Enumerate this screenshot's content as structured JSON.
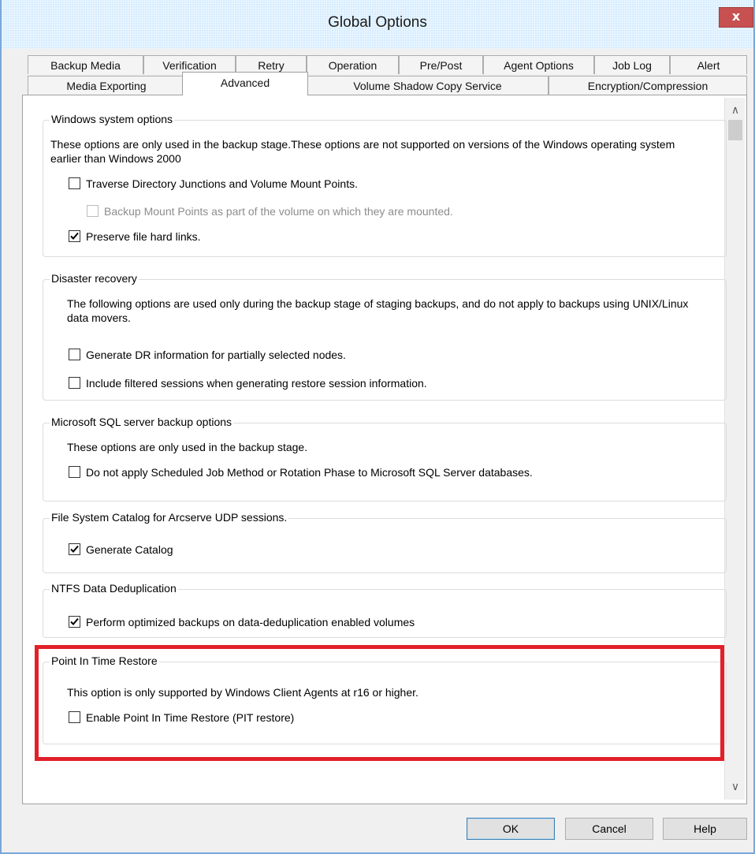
{
  "window": {
    "title": "Global Options",
    "close_glyph": "x"
  },
  "tabs_row1": [
    {
      "label": "Backup Media"
    },
    {
      "label": "Verification"
    },
    {
      "label": "Retry"
    },
    {
      "label": "Operation"
    },
    {
      "label": "Pre/Post"
    },
    {
      "label": "Agent Options"
    },
    {
      "label": "Job Log"
    },
    {
      "label": "Alert"
    }
  ],
  "tabs_row2": [
    {
      "label": "Media Exporting"
    },
    {
      "label": "Advanced",
      "active": true
    },
    {
      "label": "Volume Shadow Copy Service"
    },
    {
      "label": "Encryption/Compression"
    }
  ],
  "sections": {
    "windows": {
      "title": "Windows system options",
      "description": "These options are only used in the backup stage.These options are not supported on versions of the Windows operating system earlier than Windows 2000",
      "traverse_label": "Traverse Directory Junctions and Volume Mount Points.",
      "traverse_checked": false,
      "mount_points_label": "Backup Mount Points as part of the volume on which they are mounted.",
      "mount_points_checked": false,
      "mount_points_enabled": false,
      "hard_links_label": "Preserve file hard links.",
      "hard_links_checked": true
    },
    "disaster": {
      "title": "Disaster recovery",
      "description": "The following options are used only during the backup stage of staging backups, and do not apply to backups using UNIX/Linux data movers.",
      "dr_info_label": "Generate DR information for partially selected nodes.",
      "dr_info_checked": false,
      "filtered_label": "Include filtered sessions when generating restore session information.",
      "filtered_checked": false
    },
    "sql": {
      "title": "Microsoft SQL server backup options",
      "description": "These options are only used in the backup stage.",
      "no_apply_label": "Do not apply Scheduled Job Method or Rotation Phase to Microsoft SQL Server databases.",
      "no_apply_checked": false
    },
    "catalog": {
      "title": "File System Catalog for Arcserve UDP sessions.",
      "generate_label": "Generate Catalog",
      "generate_checked": true
    },
    "ntfs": {
      "title": "NTFS Data Deduplication",
      "optimized_label": "Perform optimized backups on data-deduplication enabled volumes",
      "optimized_checked": true
    },
    "pit": {
      "title": "Point In Time Restore",
      "description": "This option is only supported by Windows Client Agents at r16 or higher.",
      "enable_label": "Enable Point In Time Restore (PIT restore)",
      "enable_checked": false
    }
  },
  "scrollbar": {
    "up_glyph": "∧",
    "down_glyph": "∨"
  },
  "buttons": {
    "ok": "OK",
    "cancel": "Cancel",
    "help": "Help"
  },
  "colors": {
    "titlebar": "#d5ecff",
    "close_button": "#c75050",
    "highlight_border": "#e2202a"
  }
}
